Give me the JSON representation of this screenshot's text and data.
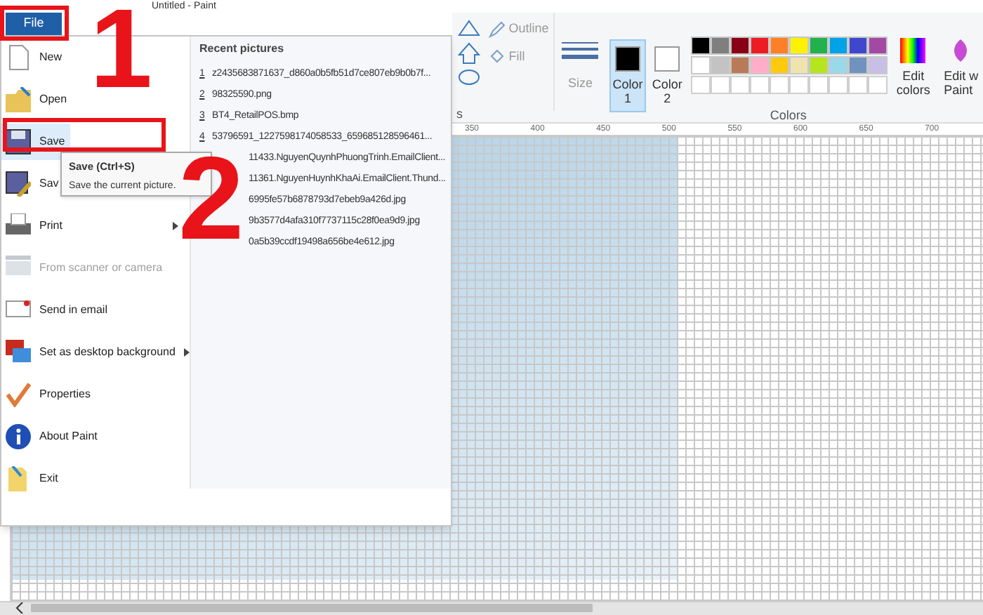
{
  "title_bar": {
    "title": "Untitled - Paint"
  },
  "file_button": {
    "label": "File",
    "selected": true
  },
  "file_menu": {
    "items": [
      {
        "label": "New",
        "disabled": false,
        "submenu": false,
        "selected": false
      },
      {
        "label": "Open",
        "disabled": false,
        "submenu": false,
        "selected": false
      },
      {
        "label": "Save",
        "disabled": false,
        "submenu": false,
        "selected": true
      },
      {
        "label": "Sav",
        "disabled": false,
        "submenu": false,
        "selected": false
      },
      {
        "label": "Print",
        "disabled": false,
        "submenu": true,
        "selected": false
      },
      {
        "label": "From scanner or camera",
        "disabled": true,
        "submenu": false,
        "selected": false
      },
      {
        "label": "Send in email",
        "disabled": false,
        "submenu": false,
        "selected": false
      },
      {
        "label": "Set as desktop background",
        "disabled": false,
        "submenu": true,
        "selected": false
      },
      {
        "label": "Properties",
        "disabled": false,
        "submenu": false,
        "selected": false
      },
      {
        "label": "About Paint",
        "disabled": false,
        "submenu": false,
        "selected": false
      },
      {
        "label": "Exit",
        "disabled": false,
        "submenu": false,
        "selected": false
      }
    ],
    "recent": {
      "heading": "Recent pictures",
      "items": [
        {
          "number": "1",
          "name": "z2435683871637_d860a0b5fb51d7ce807eb9b0b7f..."
        },
        {
          "number": "2",
          "name": "98325590.png"
        },
        {
          "number": "3",
          "name": "BT4_RetailPOS.bmp"
        },
        {
          "number": "4",
          "name": "53796591_1227598174058533_659685128596461..."
        },
        {
          "name": "11433.NguyenQuynhPhuongTrinh.EmailClient..."
        },
        {
          "name": "11361.NguyenHuynhKhaAi.EmailClient.Thund..."
        },
        {
          "name": "6995fe57b6878793d7ebeb9a426d.jpg"
        },
        {
          "name": "9b3577d4afa310f7737115c28f0ea9d9.jpg"
        },
        {
          "name": "0a5b39ccdf19498a656be4e612.jpg"
        }
      ]
    },
    "tooltip": {
      "title": "Save (Ctrl+S)",
      "text": "Save the current picture."
    }
  },
  "ribbon": {
    "shapes_label": "s",
    "outline": "Outline",
    "fill": "Fill",
    "size": "Size",
    "colors": [
      {
        "label": "Color",
        "sub": "1",
        "selected": true,
        "color": "#000000"
      },
      {
        "label": "Color",
        "sub": "2",
        "selected": false,
        "color": "#ffffff"
      }
    ],
    "palette": [
      {
        "color": "#000000"
      },
      {
        "color": "#7f7f7f"
      },
      {
        "color": "#880015"
      },
      {
        "color": "#ed1c24"
      },
      {
        "color": "#ff7f27"
      },
      {
        "color": "#fff200"
      },
      {
        "color": "#22b14c"
      },
      {
        "color": "#00a2e8"
      },
      {
        "color": "#3f48cc"
      },
      {
        "color": "#a349a4"
      },
      {
        "color": "#ffffff"
      },
      {
        "color": "#c3c3c3"
      },
      {
        "color": "#b97a57"
      },
      {
        "color": "#ffaec9"
      },
      {
        "color": "#ffc90e"
      },
      {
        "color": "#efe4b0"
      },
      {
        "color": "#b5e61d"
      },
      {
        "color": "#99d9ea"
      },
      {
        "color": "#7092be"
      },
      {
        "color": "#c8bfe7"
      }
    ],
    "colors_label": "Colors",
    "edit_colors": [
      "Edit",
      "colors"
    ],
    "paint3": [
      "Edit w",
      "Paint"
    ]
  },
  "ruler": [
    "350",
    "400",
    "450",
    "500",
    "550",
    "600",
    "650",
    "700"
  ],
  "annotations": [
    {
      "number": "1"
    },
    {
      "number": "2"
    }
  ]
}
